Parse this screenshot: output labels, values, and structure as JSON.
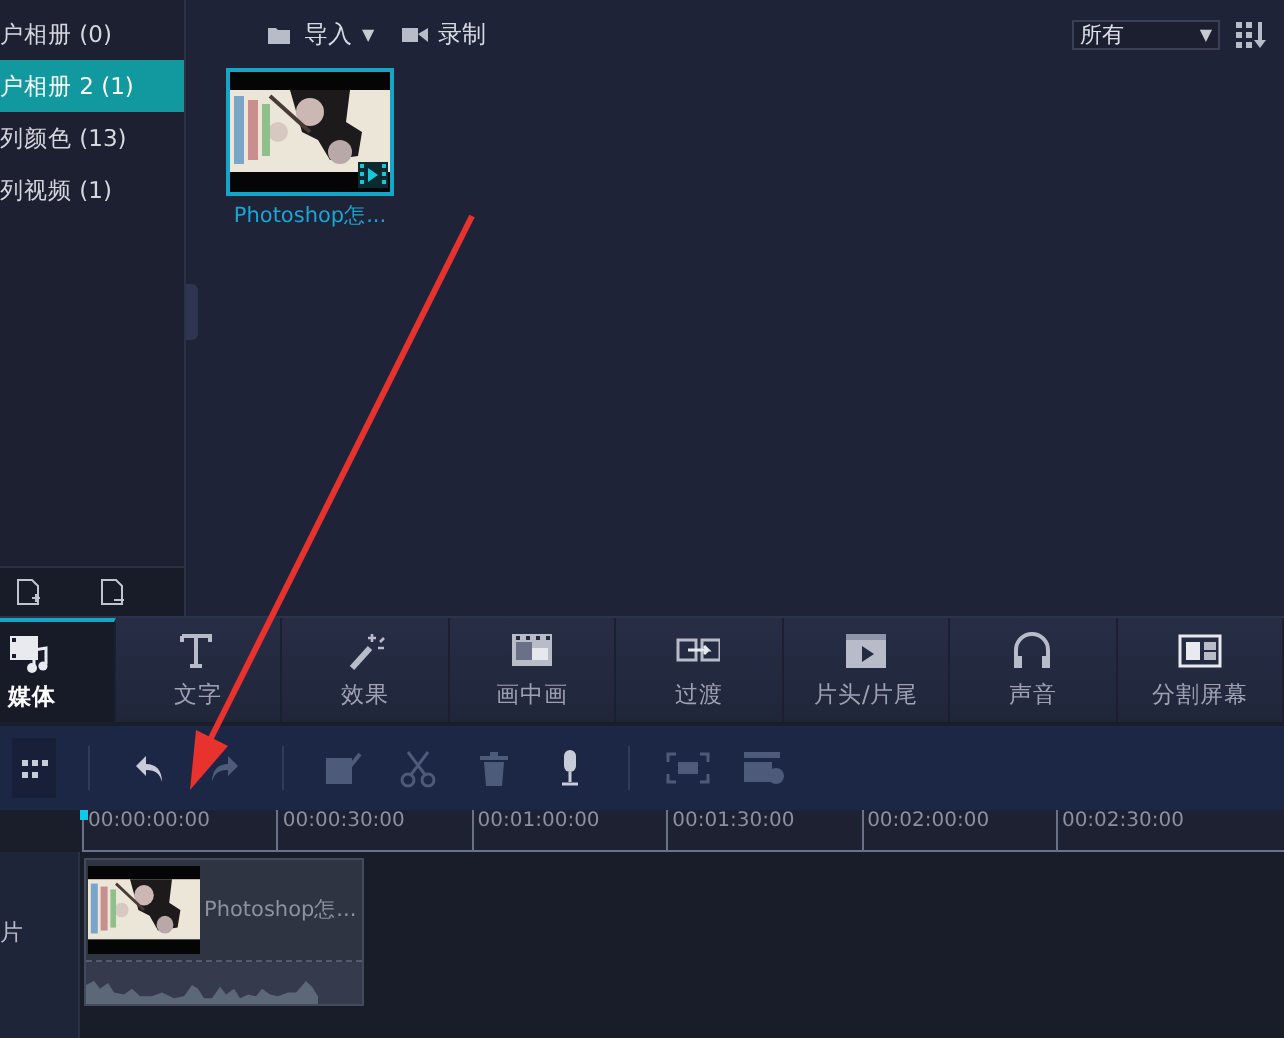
{
  "library": {
    "items": [
      {
        "label": "户相册 (0)",
        "selected": false
      },
      {
        "label": "户相册 2 (1)",
        "selected": true
      },
      {
        "label": "列颜色 (13)",
        "selected": false
      },
      {
        "label": "列视频 (1)",
        "selected": false
      }
    ]
  },
  "media_toolbar": {
    "import": "导入",
    "import_caret": "▼",
    "record": "录制",
    "filter": {
      "value": "所有",
      "caret": "▼"
    }
  },
  "media": [
    {
      "kind": "picture",
      "caption": "Photoshop怎...",
      "selected": true
    }
  ],
  "tabs": [
    {
      "label": "媒体",
      "selected": true
    },
    {
      "label": "文字",
      "selected": false
    },
    {
      "label": "效果",
      "selected": false
    },
    {
      "label": "画中画",
      "selected": false
    },
    {
      "label": "过渡",
      "selected": false
    },
    {
      "label": "片头/片尾",
      "selected": false
    },
    {
      "label": "声音",
      "selected": false
    },
    {
      "label": "分割屏幕",
      "selected": false
    }
  ],
  "timeline_toolbar": [
    {
      "kind": "grid"
    },
    {
      "kind": "sep"
    },
    {
      "kind": "undo",
      "disabled": false
    },
    {
      "kind": "redo",
      "disabled": true
    },
    {
      "kind": "sep"
    },
    {
      "kind": "edit",
      "disabled": true
    },
    {
      "kind": "cut",
      "disabled": true
    },
    {
      "kind": "trash",
      "disabled": true
    },
    {
      "kind": "mic",
      "disabled": false
    },
    {
      "kind": "sep"
    },
    {
      "kind": "fit",
      "disabled": true
    },
    {
      "kind": "settings",
      "disabled": true
    }
  ],
  "ruler": [
    "00:00:00:00",
    "00:00:30:00",
    "00:01:00:00",
    "00:01:30:00",
    "00:02:00:00",
    "00:02:30:00"
  ],
  "tracks": [
    {
      "label": "片",
      "clips": [
        {
          "kind": "picture",
          "title": "Photoshop怎..."
        }
      ]
    }
  ]
}
